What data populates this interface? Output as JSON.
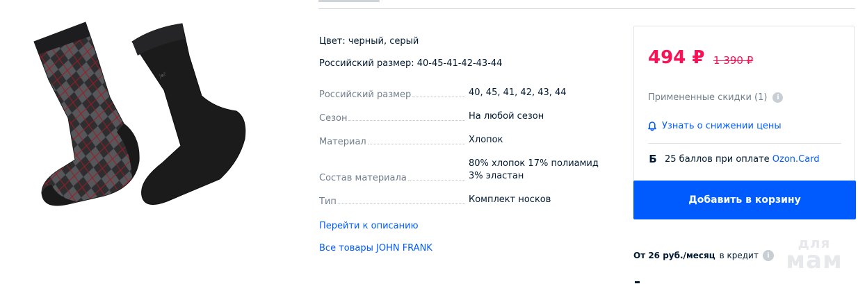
{
  "attributes": [
    {
      "key": "Цвет:",
      "value": "черный, серый"
    },
    {
      "key": "Российский размер:",
      "value": "40-45-41-42-43-44"
    }
  ],
  "specs": [
    {
      "key": "Российский размер",
      "value": "40, 45, 41, 42, 43, 44"
    },
    {
      "key": "Сезон",
      "value": "На любой сезон"
    },
    {
      "key": "Материал",
      "value": "Хлопок"
    },
    {
      "key": "Состав материала",
      "value": "80% хлопок 17% полиамид 3% эластан"
    },
    {
      "key": "Тип",
      "value": "Комплект носков"
    }
  ],
  "links": {
    "description": "Перейти к описанию",
    "brand_all": "Все товары JOHN FRANK"
  },
  "price_card": {
    "current_price": "494 ₽",
    "old_price": "1 390 ₽",
    "discounts_label": "Примененные скидки (1)",
    "notify_label": "Узнать о снижении цены",
    "bonus_icon": "Б",
    "bonus_text": "25 баллов при оплате ",
    "bonus_card": "Ozon.Card",
    "add_to_cart": "Добавить в корзину"
  },
  "credit": {
    "amount": "От 26 руб./месяц",
    "suffix": "в кредит"
  },
  "watermark": {
    "line1": "для",
    "line2": "мам"
  },
  "colors": {
    "accent": "#005bff",
    "price": "#f91155",
    "muted": "#707f8d",
    "text": "#001a34"
  },
  "icons": {
    "info": "info-icon",
    "bell": "bell-icon"
  }
}
